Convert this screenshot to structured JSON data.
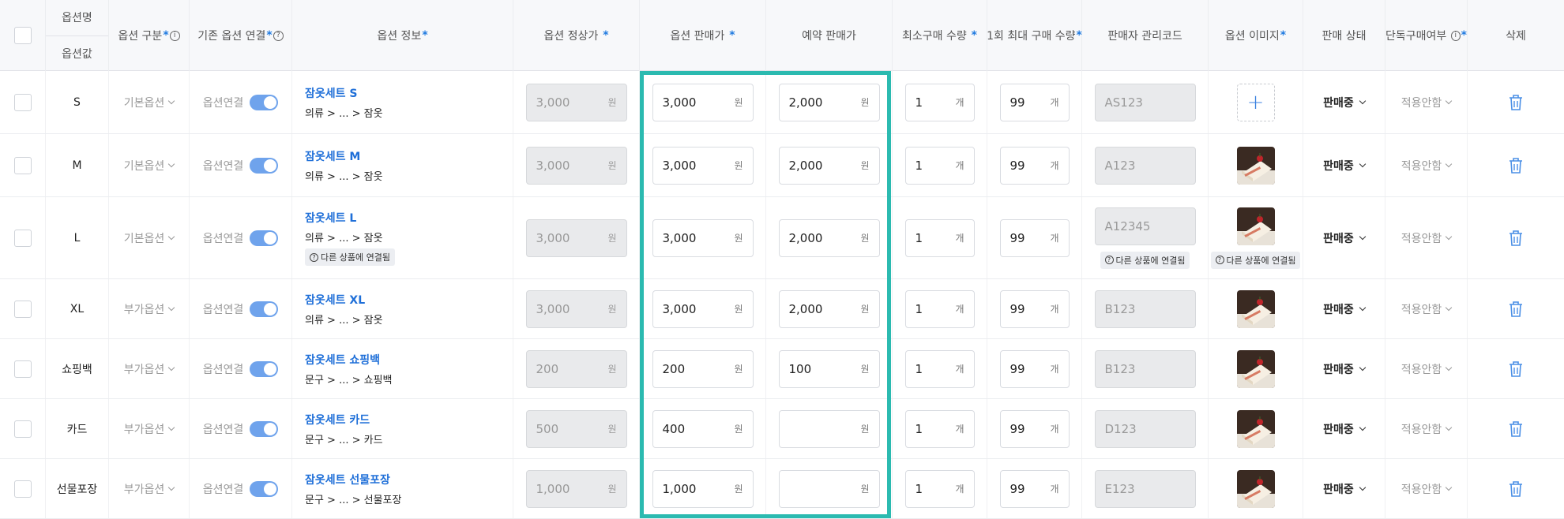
{
  "header": {
    "option_name": "옵션명",
    "option_value": "옵션값",
    "option_type": "옵션 구분",
    "existing_link": "기존 옵션 연결",
    "option_info": "옵션 정보",
    "regular_price": "옵션 정상가",
    "sale_price": "옵션 판매가",
    "reserve_price": "예약 판매가",
    "min_qty": "최소구매 수량",
    "max_qty": "1회 최대 구매 수량",
    "seller_code": "판매자 관리코드",
    "option_image": "옵션 이미지",
    "sale_status": "판매 상태",
    "solo_purchase": "단독구매여부",
    "delete": "삭제"
  },
  "linked_badge": "다른 상품에 연결됨",
  "unit_won": "원",
  "unit_count": "개",
  "link_label": "옵션연결",
  "rows": [
    {
      "value": "S",
      "type": "기본옵션",
      "name": "잠옷세트 S",
      "path": "의류 > ... > 잠옷",
      "linked": false,
      "regular": "3,000",
      "sale": "3,000",
      "reserve": "2,000",
      "min": "1",
      "max": "99",
      "code": "AS123",
      "code_linked": false,
      "image": "add",
      "image_linked": false,
      "status": "판매중",
      "solo": "적용안함"
    },
    {
      "value": "M",
      "type": "기본옵션",
      "name": "잠옷세트 M",
      "path": "의류 > ... > 잠옷",
      "linked": false,
      "regular": "3,000",
      "sale": "3,000",
      "reserve": "2,000",
      "min": "1",
      "max": "99",
      "code": "A123",
      "code_linked": false,
      "image": "cake",
      "image_linked": false,
      "status": "판매중",
      "solo": "적용안함"
    },
    {
      "value": "L",
      "type": "기본옵션",
      "name": "잠옷세트 L",
      "path": "의류 > ... > 잠옷",
      "linked": true,
      "regular": "3,000",
      "sale": "3,000",
      "reserve": "2,000",
      "min": "1",
      "max": "99",
      "code": "A12345",
      "code_linked": true,
      "image": "cake",
      "image_linked": true,
      "status": "판매중",
      "solo": "적용안함"
    },
    {
      "value": "XL",
      "type": "부가옵션",
      "name": "잠옷세트 XL",
      "path": "의류 > ... > 잠옷",
      "linked": false,
      "regular": "3,000",
      "sale": "3,000",
      "reserve": "2,000",
      "min": "1",
      "max": "99",
      "code": "B123",
      "code_linked": false,
      "image": "cake",
      "image_linked": false,
      "status": "판매중",
      "solo": "적용안함"
    },
    {
      "value": "쇼핑백",
      "type": "부가옵션",
      "name": "잠옷세트 쇼핑백",
      "path": "문구 > ... > 쇼핑백",
      "linked": false,
      "regular": "200",
      "sale": "200",
      "reserve": "100",
      "min": "1",
      "max": "99",
      "code": "B123",
      "code_linked": false,
      "image": "cake",
      "image_linked": false,
      "status": "판매중",
      "solo": "적용안함"
    },
    {
      "value": "카드",
      "type": "부가옵션",
      "name": "잠옷세트 카드",
      "path": "문구 > ... > 카드",
      "linked": false,
      "regular": "500",
      "sale": "400",
      "reserve": "",
      "min": "1",
      "max": "99",
      "code": "D123",
      "code_linked": false,
      "image": "cake",
      "image_linked": false,
      "status": "판매중",
      "solo": "적용안함"
    },
    {
      "value": "선물포장",
      "type": "부가옵션",
      "name": "잠옷세트 선물포장",
      "path": "문구 > ... > 선물포장",
      "linked": false,
      "regular": "1,000",
      "sale": "1,000",
      "reserve": "",
      "min": "1",
      "max": "99",
      "code": "E123",
      "code_linked": false,
      "image": "cake",
      "image_linked": false,
      "status": "판매중",
      "solo": "적용안함"
    }
  ],
  "colors": {
    "accent": "#1f7ae0",
    "highlight": "#2bbab0",
    "toggle": "#6fa3ec"
  }
}
